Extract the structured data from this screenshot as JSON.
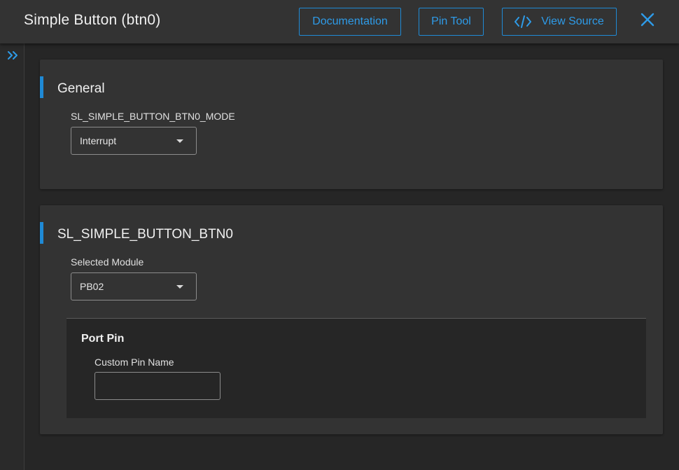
{
  "header": {
    "title": "Simple Button (btn0)",
    "buttons": {
      "documentation": "Documentation",
      "pin_tool": "Pin Tool",
      "view_source": "View Source"
    },
    "icons": {
      "code": "code-icon",
      "close": "close-icon"
    }
  },
  "sidebar": {
    "expand_icon": "double-chevron-right-icon"
  },
  "sections": {
    "general": {
      "title": "General",
      "mode_label": "SL_SIMPLE_BUTTON_BTN0_MODE",
      "mode_value": "Interrupt"
    },
    "btn0": {
      "title": "SL_SIMPLE_BUTTON_BTN0",
      "module_label": "Selected Module",
      "module_value": "PB02",
      "port_pin": {
        "title": "Port Pin",
        "custom_pin_label": "Custom Pin Name",
        "custom_pin_value": "",
        "custom_pin_placeholder": ""
      }
    }
  },
  "colors": {
    "accent": "#1f8ad6",
    "background": "#262626",
    "panel": "#333333",
    "text": "#e6e6e6"
  }
}
